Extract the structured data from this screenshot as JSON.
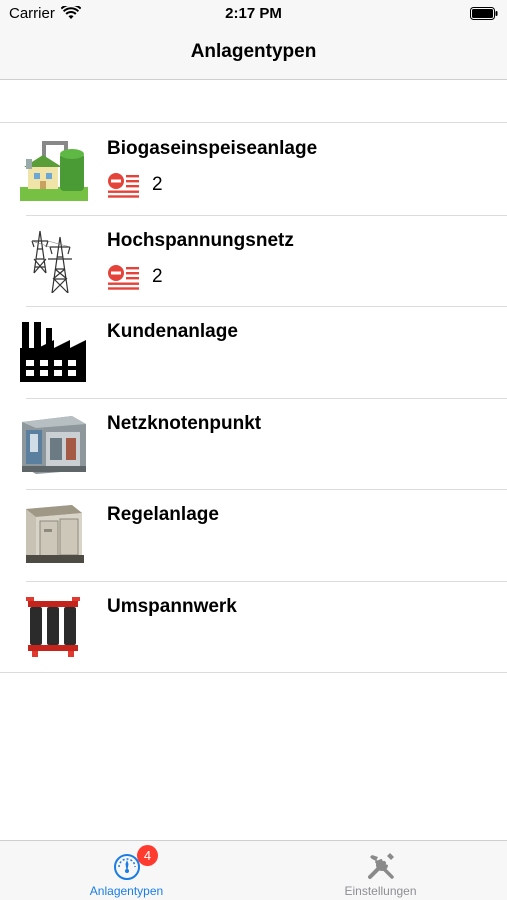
{
  "status_bar": {
    "carrier": "Carrier",
    "time": "2:17 PM"
  },
  "nav": {
    "title": "Anlagentypen"
  },
  "rows": [
    {
      "title": "Biogaseinspeiseanlage",
      "count": "2",
      "icon": "biogas-plant-icon"
    },
    {
      "title": "Hochspannungsnetz",
      "count": "2",
      "icon": "power-pylon-icon"
    },
    {
      "title": "Kundenanlage",
      "icon": "factory-icon"
    },
    {
      "title": "Netzknotenpunkt",
      "icon": "grid-node-icon"
    },
    {
      "title": "Regelanlage",
      "icon": "control-cabinet-icon"
    },
    {
      "title": "Umspannwerk",
      "icon": "transformer-icon"
    }
  ],
  "tabs": [
    {
      "label": "Anlagentypen",
      "badge": "4",
      "icon": "gauge-icon",
      "active": true
    },
    {
      "label": "Einstellungen",
      "icon": "tools-icon",
      "active": false
    }
  ],
  "colors": {
    "accent": "#1a7de3",
    "badge": "#ff3b30",
    "list_icon": "#e5423a"
  }
}
